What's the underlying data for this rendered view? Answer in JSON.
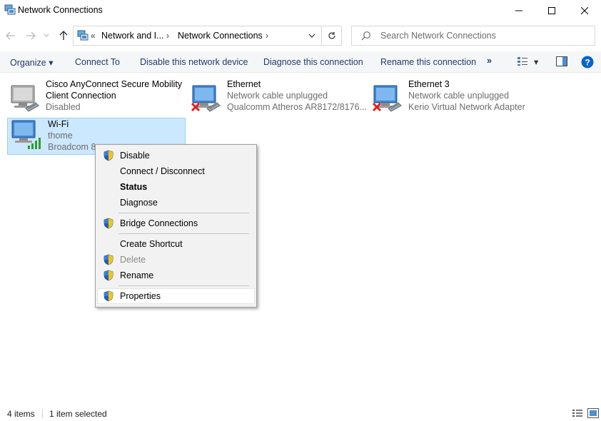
{
  "window": {
    "title": "Network Connections",
    "icons": [
      "network-connections-icon",
      "minimize-icon",
      "maximize-icon",
      "close-icon"
    ]
  },
  "address_bar": {
    "overflow": "«",
    "crumbs": [
      "Network and I...",
      "Network Connections"
    ]
  },
  "search": {
    "placeholder": "Search Network Connections"
  },
  "toolbar": {
    "organize": "Organize",
    "connect_to": "Connect To",
    "disable_device": "Disable this network device",
    "diagnose": "Diagnose this connection",
    "rename": "Rename this connection",
    "more": "»"
  },
  "connections": [
    {
      "name1": "Cisco AnyConnect Secure Mobility",
      "name2": "Client Connection",
      "status": "Disabled",
      "device": ""
    },
    {
      "name1": "Ethernet",
      "name2": "",
      "status": "Network cable unplugged",
      "device": "Qualcomm Atheros AR8172/8176..."
    },
    {
      "name1": "Ethernet 3",
      "name2": "",
      "status": "Network cable unplugged",
      "device": "Kerio Virtual Network Adapter"
    },
    {
      "name1": "Wi-Fi",
      "name2": "",
      "status": "thome",
      "device": "Broadcom 8"
    }
  ],
  "context_menu": {
    "disable": "Disable",
    "connect_disconnect": "Connect / Disconnect",
    "status": "Status",
    "diagnose": "Diagnose",
    "bridge": "Bridge Connections",
    "create_shortcut": "Create Shortcut",
    "delete": "Delete",
    "rename": "Rename",
    "properties": "Properties"
  },
  "status_bar": {
    "items_count": "4 items",
    "selected": "1 item selected"
  },
  "colors": {
    "selection_bg": "#cce8ff",
    "selection_border": "#99d1ff",
    "command_text": "#1e3b6e",
    "help_blue": "#0a64c8",
    "error_red": "#e0201b",
    "signal_green": "#2e9b2e"
  }
}
